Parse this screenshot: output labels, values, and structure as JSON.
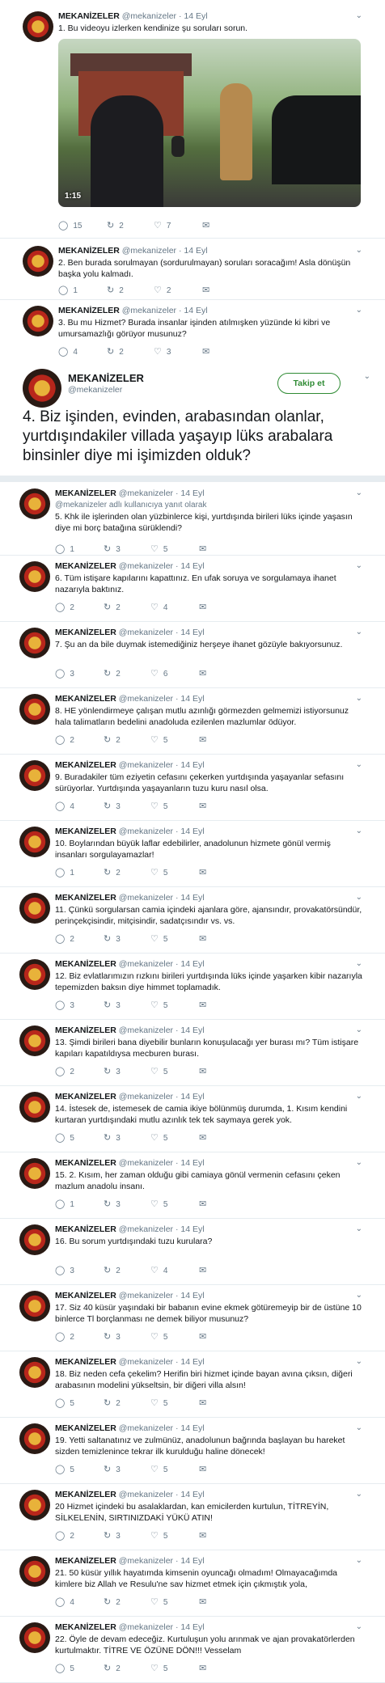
{
  "user": {
    "name": "MEKANİZELER",
    "handle": "@mekanizeler",
    "dot": "·"
  },
  "icons": {
    "reply": "reply-icon",
    "retweet": "retweet-icon",
    "like": "like-icon",
    "dm": "dm-icon",
    "chevron": "chevron-down-icon"
  },
  "colors": {
    "follow": "#2f8b34",
    "muted": "#657786"
  },
  "top_tweets": [
    {
      "date": "14 Eyl",
      "text": "1. Bu videoyu izlerken kendinize şu soruları sorun.",
      "replies": "15",
      "retweets": "2",
      "likes": "7",
      "video_time": "1:15"
    },
    {
      "date": "14 Eyl",
      "text": "2. Ben burada sorulmayan (sordurulmayan) soruları soracağım! Asla dönüşün başka yolu kalmadı.",
      "replies": "1",
      "retweets": "2",
      "likes": "2"
    },
    {
      "date": "14 Eyl",
      "text": "3. Bu mu Hizmet? Burada insanlar işinden atılmışken yüzünde ki kibri ve umursamazlığı görüyor musunuz?",
      "replies": "4",
      "retweets": "2",
      "likes": "3"
    }
  ],
  "focused": {
    "name": "MEKANİZELER",
    "handle": "@mekanizeler",
    "follow_label": "Takip et",
    "text": "4. Biz işinden, evinden, arabasından olanlar, yurtdışındakiler villada yaşayıp lüks arabalara binsinler diye mi işimizden olduk?"
  },
  "replies": [
    {
      "date": "14 Eyl",
      "reply_note": "@mekanizeler adlı kullanıcıya yanıt olarak",
      "text": "5. Khk ile işlerinden olan yüzbinlerce kişi, yurtdışında birileri lüks içinde yaşasın diye mi borç batağına sürüklendi?",
      "replies": "1",
      "retweets": "3",
      "likes": "5"
    },
    {
      "date": "14 Eyl",
      "text": "6. Tüm istişare kapılarını kapattınız. En ufak soruya ve sorgulamaya ihanet nazarıyla baktınız.",
      "replies": "2",
      "retweets": "2",
      "likes": "4"
    },
    {
      "date": "14 Eyl",
      "text": "7. Şu an da bile duymak istemediğiniz herşeye ihanet gözüyle bakıyorsunuz.",
      "replies": "3",
      "retweets": "2",
      "likes": "6"
    },
    {
      "date": "14 Eyl",
      "text": "8. HE yönlendirmeye çalışan mutlu azınlığı görmezden gelmemizi istiyorsunuz hala talimatların bedelini anadoluda ezilenlen mazlumlar ödüyor.",
      "replies": "2",
      "retweets": "2",
      "likes": "5"
    },
    {
      "date": "14 Eyl",
      "text": "9. Buradakiler tüm eziyetin cefasını çekerken yurtdışında yaşayanlar sefasını sürüyorlar. Yurtdışında yaşayanların tuzu kuru nasıl olsa.",
      "replies": "4",
      "retweets": "3",
      "likes": "5"
    },
    {
      "date": "14 Eyl",
      "text": "10. Boylarından büyük laflar edebilirler, anadolunun hizmete gönül vermiş insanları sorgulayamazlar!",
      "replies": "1",
      "retweets": "2",
      "likes": "5"
    },
    {
      "date": "14 Eyl",
      "text": "11. Çünkü sorgularsan camia içindeki ajanlara göre, ajansındır, provakatörsündür, perinçekçisindir, mitçisindir, sadatçısındır vs. vs.",
      "replies": "2",
      "retweets": "3",
      "likes": "5"
    },
    {
      "date": "14 Eyl",
      "text": "12. Biz evlatlarımızın rızkını birileri yurtdışında lüks içinde yaşarken kibir nazarıyla tepemizden baksın diye himmet toplamadık.",
      "replies": "3",
      "retweets": "3",
      "likes": "5"
    },
    {
      "date": "14 Eyl",
      "text": "13. Şimdi birileri bana diyebilir bunların konuşulacağı yer burası mı? Tüm istişare kapıları kapatıldıysa mecburen burası.",
      "replies": "2",
      "retweets": "3",
      "likes": "5"
    },
    {
      "date": "14 Eyl",
      "text": "14. İstesek de, istemesek de camia ikiye bölünmüş durumda, 1. Kısım kendini kurtaran yurtdışındaki mutlu azınlık tek tek saymaya gerek yok.",
      "replies": "5",
      "retweets": "3",
      "likes": "5"
    },
    {
      "date": "14 Eyl",
      "text": "15. 2. Kısım, her zaman olduğu gibi camiaya gönül vermenin cefasını çeken mazlum anadolu insanı.",
      "replies": "1",
      "retweets": "3",
      "likes": "5"
    },
    {
      "date": "14 Eyl",
      "text": "16. Bu sorum yurtdışındaki tuzu kurulara?",
      "replies": "3",
      "retweets": "2",
      "likes": "4"
    },
    {
      "date": "14 Eyl",
      "text": "17. Siz 40 küsür yaşındaki bir babanın evine ekmek götüremeyip bir de üstüne 10 binlerce Tl borçlanması ne demek biliyor musunuz?",
      "replies": "2",
      "retweets": "3",
      "likes": "5"
    },
    {
      "date": "14 Eyl",
      "text": "18. Biz neden cefa çekelim? Herifin biri hizmet içinde bayan avına çıksın, diğeri arabasının modelini yükseltsin, bir diğeri villa alsın!",
      "replies": "5",
      "retweets": "2",
      "likes": "5"
    },
    {
      "date": "14 Eyl",
      "text": "19. Yetti saltanatınız ve zulmünüz, anadolunun bağrında başlayan bu hareket sizden temizlenince tekrar ilk kurulduğu haline dönecek!",
      "replies": "5",
      "retweets": "3",
      "likes": "5"
    },
    {
      "date": "14 Eyl",
      "text": "20 Hizmet içindeki bu asalaklardan, kan emicilerden kurtulun, TİTREYİN, SİLKELENİN, SIRTINIZDAKİ YÜKÜ ATIN!",
      "replies": "2",
      "retweets": "3",
      "likes": "5"
    },
    {
      "date": "14 Eyl",
      "text": "21. 50 küsür yıllık hayatımda kimsenin oyuncağı olmadım! Olmayacağımda kimlere biz Allah ve Resulu'ne sav hizmet etmek için çıkmıştık yola,",
      "replies": "4",
      "retweets": "2",
      "likes": "5"
    },
    {
      "date": "14 Eyl",
      "text": "22. Öyle de devam edeceğiz. Kurtuluşun yolu arınmak ve ajan provakatörlerden kurtulmaktır. TİTRE VE ÖZÜNE DÖN!!! Vesselam",
      "replies": "5",
      "retweets": "2",
      "likes": "5"
    }
  ]
}
